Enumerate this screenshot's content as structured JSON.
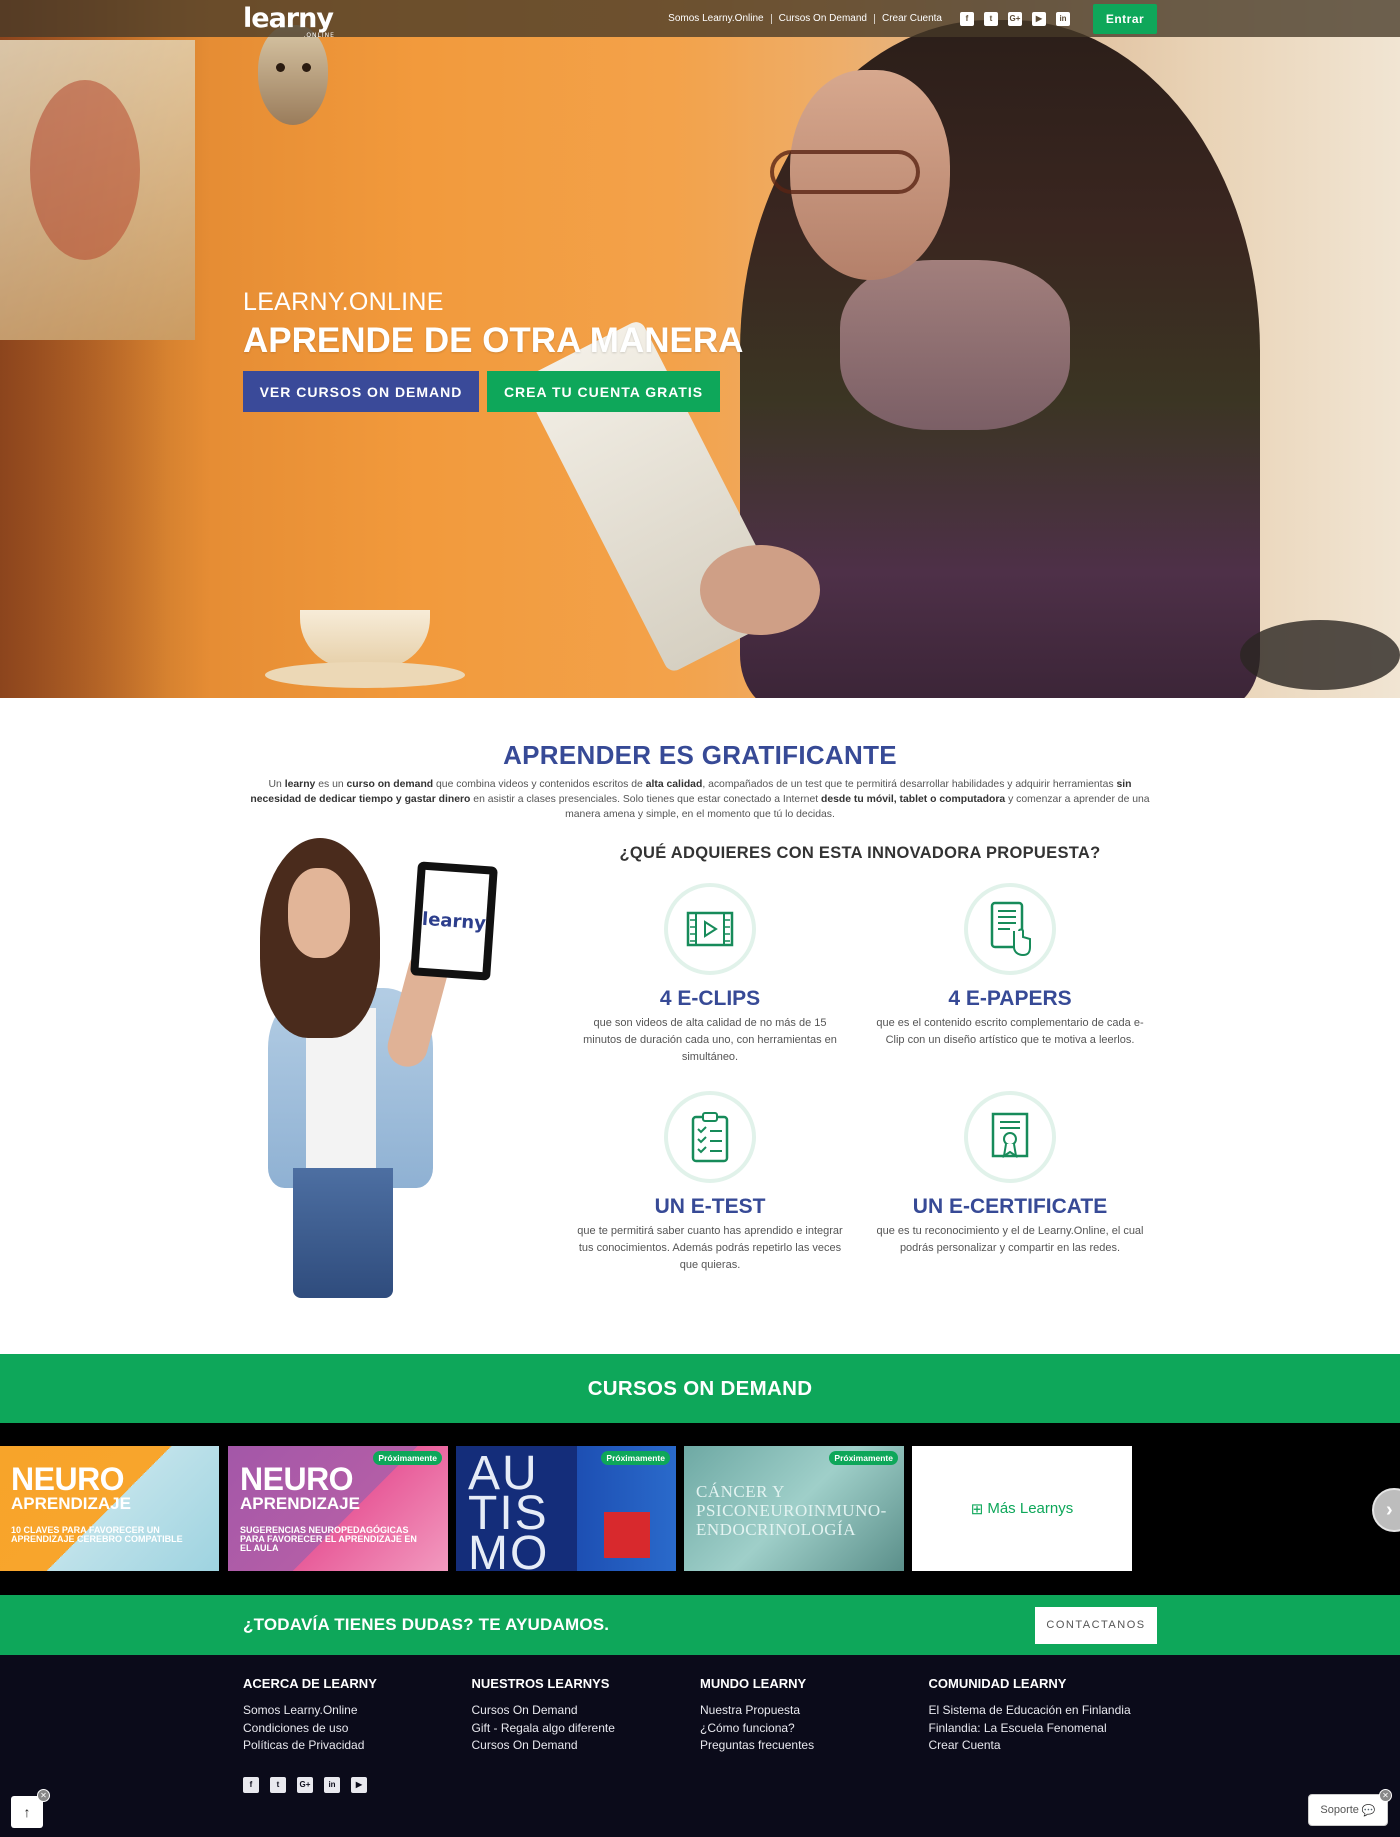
{
  "header": {
    "logo": "learny",
    "logo_sub": ".ONLINE",
    "nav": [
      "Somos Learny.Online",
      "Cursos On Demand",
      "Crear Cuenta"
    ],
    "social_icons": [
      "facebook-icon",
      "twitter-icon",
      "google-plus-icon",
      "youtube-icon",
      "linkedin-icon"
    ],
    "login_label": "Entrar"
  },
  "hero": {
    "subtitle": "LEARNY.ONLINE",
    "title": "APRENDE DE OTRA MANERA",
    "btn_courses": "VER CURSOS ON DEMAND",
    "btn_account": "CREA TU CUENTA GRATIS"
  },
  "intro": {
    "title": "APRENDER ES GRATIFICANTE",
    "lead": [
      {
        "t": "Un ",
        "b": false
      },
      {
        "t": "learny",
        "b": true
      },
      {
        "t": " es un ",
        "b": false
      },
      {
        "t": "curso on demand",
        "b": true
      },
      {
        "t": " que combina videos y contenidos escritos de ",
        "b": false
      },
      {
        "t": "alta calidad",
        "b": true
      },
      {
        "t": ", acompañados de un test que te permitirá desarrollar habilidades y adquirir herramientas ",
        "b": false
      },
      {
        "t": "sin necesidad de dedicar tiempo y gastar dinero",
        "b": true
      },
      {
        "t": " en asistir a clases presenciales. Solo tienes que estar conectado a Internet ",
        "b": false
      },
      {
        "t": "desde tu móvil, tablet o computadora",
        "b": true
      },
      {
        "t": " y comenzar a aprender de una manera amena y simple, en el momento que tú lo decidas.",
        "b": false
      }
    ],
    "tablet_logo": "learny",
    "features_title": "¿QUÉ ADQUIERES CON ESTA INNOVADORA PROPUESTA?",
    "features": [
      {
        "icon": "video-film-icon",
        "title": "4 E-CLIPS",
        "text": "que son videos de alta calidad de no más de 15 minutos de duración cada uno, con herramientas en simultáneo."
      },
      {
        "icon": "tablet-touch-icon",
        "title": "4 E-PAPERS",
        "text": "que es el contenido escrito complementario de cada e-Clip con un diseño artístico que te motiva a leerlos."
      },
      {
        "icon": "clipboard-checklist-icon",
        "title": "UN E-TEST",
        "text": "que te permitirá saber cuanto has aprendido e integrar tus conocimientos. Además podrás repetirlo las veces que quieras."
      },
      {
        "icon": "certificate-icon",
        "title": "UN E-CERTIFICATE",
        "text": "que es tu reconocimiento y el de Learny.Online, el cual podrás personalizar y compartir en las redes."
      }
    ]
  },
  "cursos": {
    "title": "CURSOS ON DEMAND",
    "cards": [
      {
        "t1": "NEURO",
        "t2": "APRENDIZAJE",
        "t3": "10 CLAVES PARA FAVORECER UN APRENDIZAJE CEREBRO COMPATIBLE",
        "badge": ""
      },
      {
        "t1": "NEURO",
        "t2": "APRENDIZAJE",
        "t3": "SUGERENCIAS NEUROPEDAGÓGICAS PARA FAVORECER EL APRENDIZAJE EN EL AULA",
        "badge": "Próximamente"
      },
      {
        "t1": "AU TIS MO",
        "t2": "",
        "t3": "",
        "badge": "Próximamente"
      },
      {
        "t1": "CÁNCER Y PSICONEUROINMUNO-ENDOCRINOLOGÍA",
        "t2": "",
        "t3": "",
        "badge": "Próximamente"
      }
    ],
    "more_label": "Más Learnys"
  },
  "dudas": {
    "title": "¿TODAVÍA TIENES DUDAS? TE AYUDAMOS.",
    "button": "CONTACTANOS"
  },
  "footer": {
    "cols": [
      {
        "title": "ACERCA DE LEARNY",
        "links": [
          "Somos Learny.Online",
          "Condiciones de uso",
          "Políticas de Privacidad"
        ]
      },
      {
        "title": "NUESTROS LEARNYS",
        "links": [
          "Cursos On Demand",
          "Gift - Regala algo diferente",
          "Cursos On Demand"
        ]
      },
      {
        "title": "MUNDO LEARNY",
        "links": [
          "Nuestra Propuesta",
          "¿Cómo funciona?",
          "Preguntas frecuentes"
        ]
      },
      {
        "title": "COMUNIDAD LEARNY",
        "links": [
          "El Sistema de Educación en Finlandia",
          "Finlandia: La Escuela Fenomenal",
          "Crear Cuenta"
        ]
      }
    ],
    "social_icons": [
      "facebook-icon",
      "twitter-icon",
      "google-plus-icon",
      "linkedin-icon",
      "youtube-icon"
    ]
  },
  "widgets": {
    "support_label": "Soporte"
  },
  "colors": {
    "green": "#0ea75a",
    "blue": "#3a4a99",
    "footer_bg": "#0b0b1a"
  }
}
